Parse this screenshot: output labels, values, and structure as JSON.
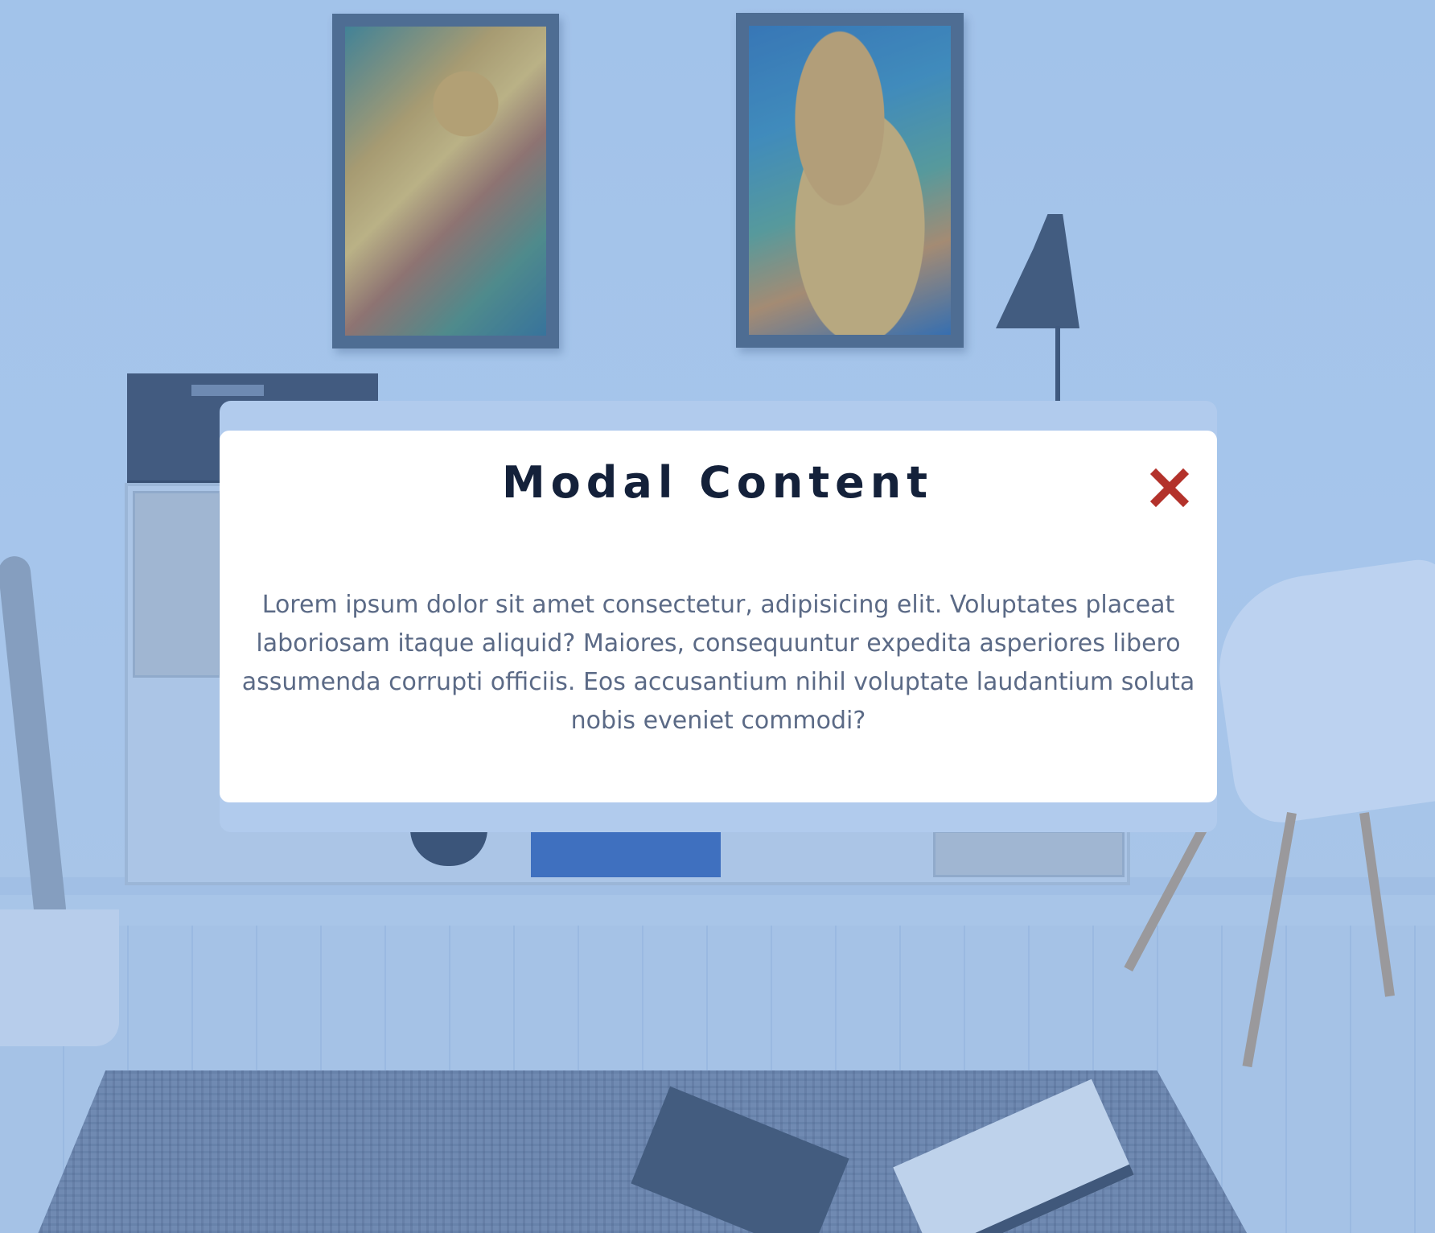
{
  "modal": {
    "title": "Modal Content",
    "body": "Lorem ipsum dolor sit amet consectetur, adipisicing elit. Voluptates placeat laboriosam itaque aliquid? Maiores, consequuntur expedita asperiores libero assumenda corrupti officiis. Eos accusantium nihil voluptate laudantium soluta nobis eveniet commodi?",
    "close_icon": "close-icon"
  },
  "colors": {
    "title": "#14213a",
    "body_text": "#5b6a86",
    "close": "#b3322b",
    "modal_bg": "#ffffff",
    "modal_border": "#b1cbed"
  }
}
